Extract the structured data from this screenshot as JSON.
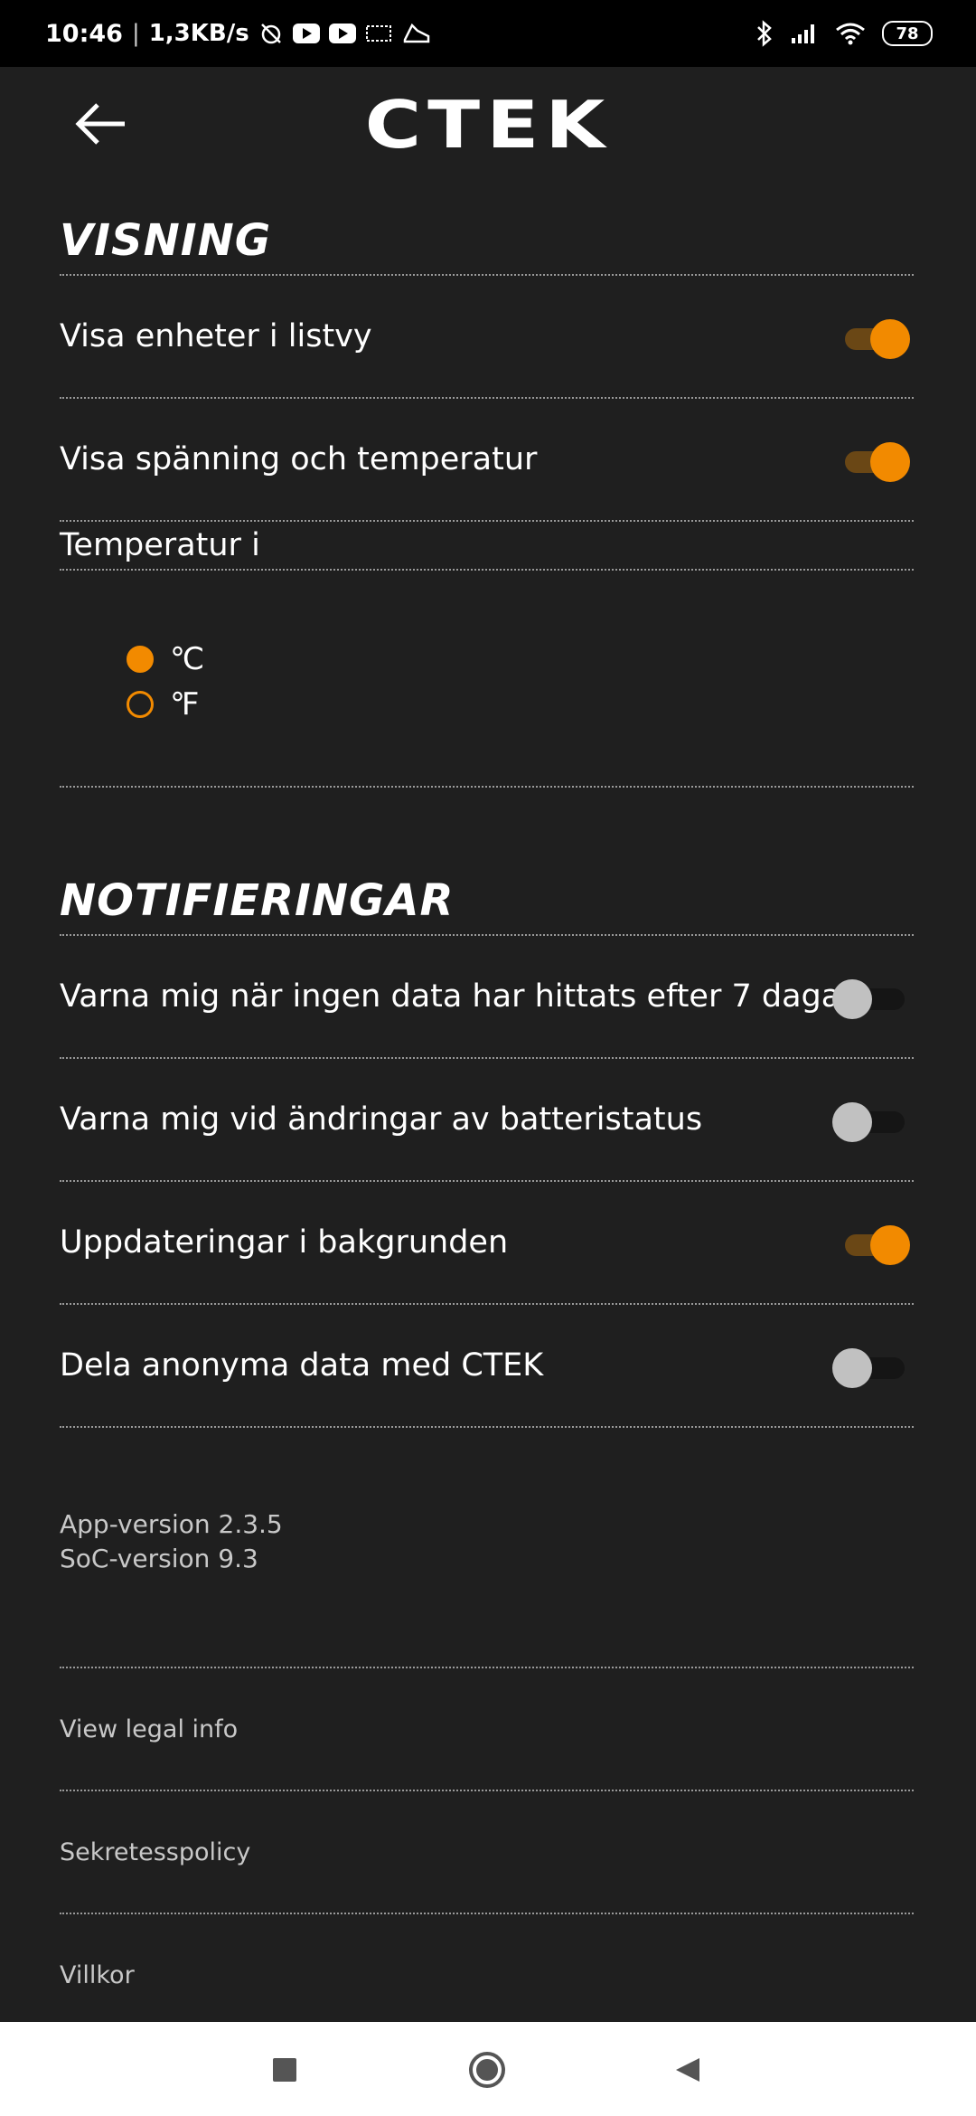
{
  "status_bar": {
    "time": "10:46",
    "speed": "1,3KB/s",
    "battery": "78"
  },
  "header": {
    "logo": "CTEK"
  },
  "display_section": {
    "title": "VISNING",
    "rows": [
      {
        "label": "Visa enheter i listvy",
        "on": true
      },
      {
        "label": "Visa spänning och temperatur",
        "on": true
      }
    ],
    "temperature_label": "Temperatur i",
    "temperature_options": [
      {
        "label": "℃",
        "selected": true
      },
      {
        "label": "℉",
        "selected": false
      }
    ]
  },
  "notifications_section": {
    "title": "NOTIFIERINGAR",
    "rows": [
      {
        "label": "Varna mig när ingen data har hittats efter 7 dagar",
        "on": false
      },
      {
        "label": "Varna mig vid ändringar av batteristatus",
        "on": false
      },
      {
        "label": "Uppdateringar i bakgrunden",
        "on": true
      },
      {
        "label": "Dela anonyma data med CTEK",
        "on": false
      }
    ]
  },
  "versions": {
    "app": "App-version 2.3.5",
    "soc": "SoC-version 9.3"
  },
  "links": {
    "legal": "View legal info",
    "privacy": "Sekretesspolicy",
    "terms": "Villkor"
  },
  "colors": {
    "accent": "#f28a00",
    "background": "#1f1f1f"
  }
}
